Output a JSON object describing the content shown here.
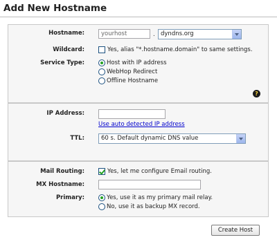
{
  "page": {
    "title": "Add New Hostname"
  },
  "hostname_section": {
    "hostname_label": "Hostname:",
    "hostname_value": "yourhost",
    "separator": ".",
    "domain_selected": "dyndns.org",
    "wildcard_label": "Wildcard:",
    "wildcard_checked": false,
    "wildcard_text": "Yes, alias \"*.hostname.domain\" to same settings.",
    "service_type_label": "Service Type:",
    "service_options": [
      {
        "label": "Host with IP address",
        "selected": true
      },
      {
        "label": "WebHop Redirect",
        "selected": false
      },
      {
        "label": "Offline Hostname",
        "selected": false
      }
    ],
    "help_icon": "help-icon"
  },
  "ip_section": {
    "ip_label": "IP Address:",
    "ip_value": "",
    "auto_detect_link": "Use auto detected IP address",
    "ttl_label": "TTL:",
    "ttl_selected": "60 s. Default dynamic DNS value"
  },
  "mail_section": {
    "mail_routing_label": "Mail Routing:",
    "mail_routing_checked": true,
    "mail_routing_text": "Yes, let me configure Email routing.",
    "mx_label": "MX Hostname:",
    "mx_value": "",
    "primary_label": "Primary:",
    "primary_options": [
      {
        "label": "Yes, use it as my primary mail relay.",
        "selected": true
      },
      {
        "label": "No, use it as backup MX record.",
        "selected": false
      }
    ]
  },
  "actions": {
    "create_label": "Create Host"
  }
}
